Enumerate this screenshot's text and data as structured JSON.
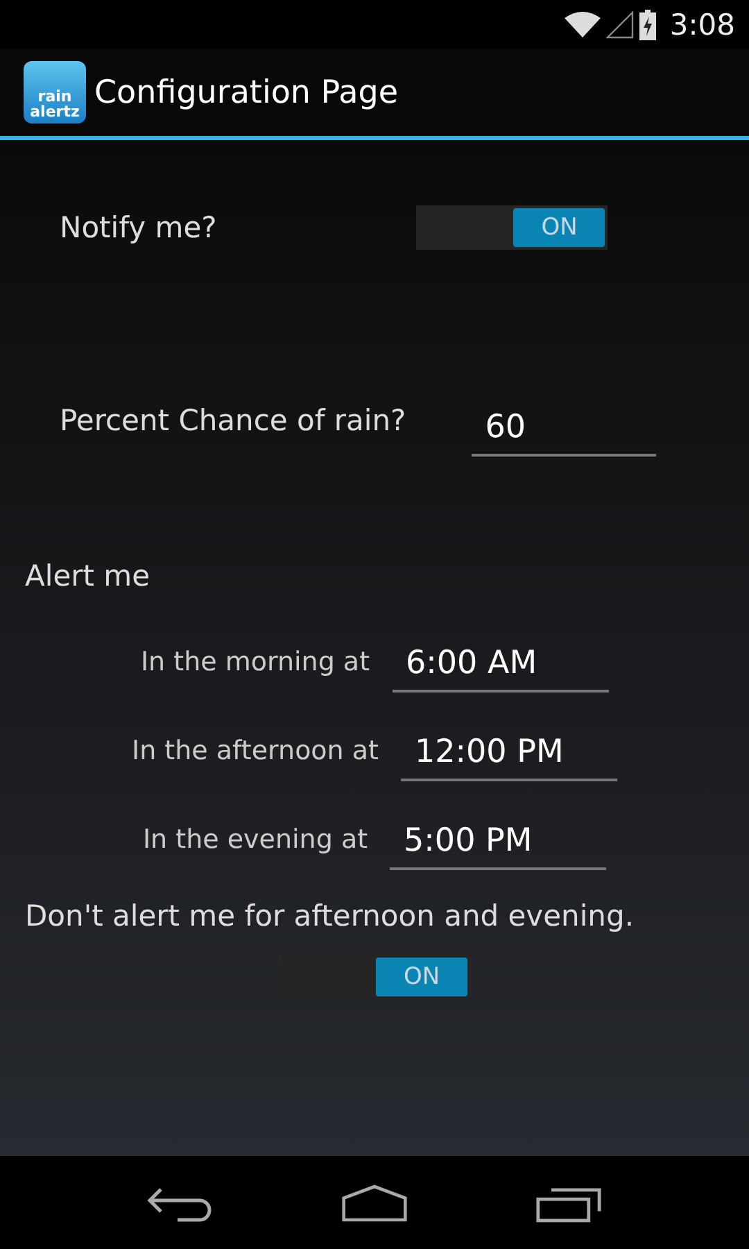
{
  "status_bar": {
    "time": "3:08"
  },
  "action_bar": {
    "app_icon": {
      "line_1": "rain",
      "line_2": "alertz"
    },
    "title": "Configuration Page"
  },
  "notify": {
    "label": "Notify me?",
    "toggle": {
      "text": "ON",
      "on": true
    }
  },
  "percent": {
    "label": "Percent Chance of rain?",
    "value": "60"
  },
  "alert_heading": "Alert me",
  "alert_times": [
    {
      "label": "In the morning at",
      "value": "6:00 AM"
    },
    {
      "label": "In the afternoon at",
      "value": "12:00 PM"
    },
    {
      "label": "In the evening at",
      "value": "5:00 PM"
    }
  ],
  "no_alert": {
    "label": "Don't alert me for afternoon and evening.",
    "toggle": {
      "text": "ON",
      "on": true
    }
  }
}
